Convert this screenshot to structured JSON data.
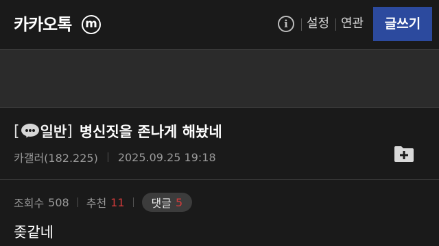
{
  "header": {
    "gallery_name": "카카오톡",
    "minor_gallery_badge": "m",
    "info_icon": "i",
    "settings_label": "설정",
    "related_label": "연관",
    "write_button_label": "글쓰기"
  },
  "post": {
    "bracket_open": "[",
    "category": "일반",
    "bracket_close": "]",
    "title": "병신짓을 존나게 해놨네",
    "author": "카갤러(182.225)",
    "date": "2025.09.25 19:18",
    "views_label": "조회수",
    "views": "508",
    "recommend_label": "추천",
    "recommend": "11",
    "comments_label": "댓글",
    "comments": "5",
    "body": "좆같네"
  },
  "colors": {
    "background": "#1a1a1a",
    "write_button": "#2c4a9e",
    "accent_red": "#d43b3b",
    "banner": "#2b2b2b"
  },
  "icons": [
    "minor-gallery-icon",
    "info-icon",
    "chat-bubble-icon",
    "folder-add-icon"
  ]
}
